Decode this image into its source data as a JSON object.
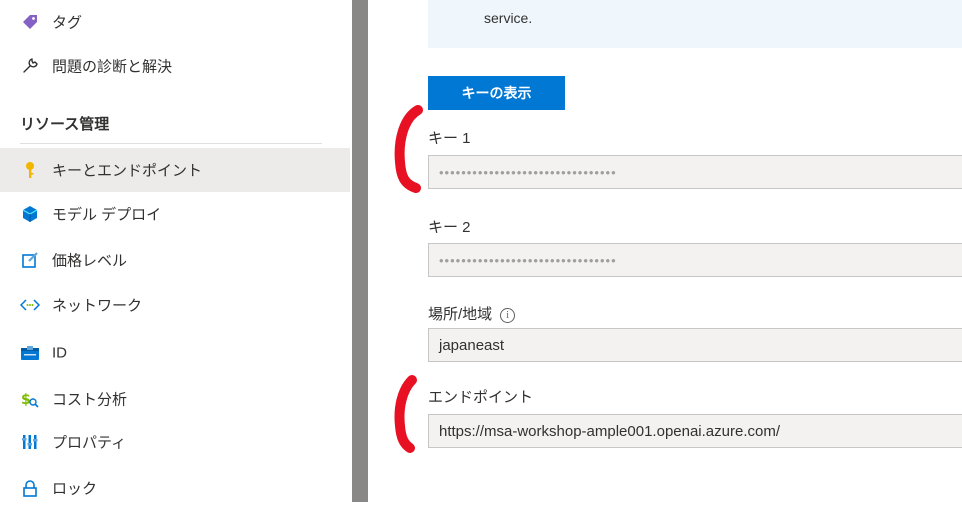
{
  "sidebar": {
    "items_top": [
      {
        "label": "タグ",
        "icon": "tag-icon"
      },
      {
        "label": "問題の診断と解決",
        "icon": "wrench-icon"
      }
    ],
    "section_header": "リソース管理",
    "items": [
      {
        "label": "キーとエンドポイント",
        "icon": "key-icon",
        "active": true
      },
      {
        "label": "モデル デプロイ",
        "icon": "cube-icon"
      },
      {
        "label": "価格レベル",
        "icon": "edit-square-icon"
      },
      {
        "label": "ネットワーク",
        "icon": "network-icon"
      },
      {
        "label": "ID",
        "icon": "id-card-icon"
      },
      {
        "label": "コスト分析",
        "icon": "cost-analysis-icon"
      },
      {
        "label": "プロパティ",
        "icon": "properties-icon"
      },
      {
        "label": "ロック",
        "icon": "lock-icon"
      }
    ]
  },
  "main": {
    "info_text": "service.",
    "show_keys_button": "キーの表示",
    "key1": {
      "label": "キー 1",
      "value": "••••••••••••••••••••••••••••••••"
    },
    "key2": {
      "label": "キー 2",
      "value": "••••••••••••••••••••••••••••••••"
    },
    "location": {
      "label": "場所/地域",
      "info_icon": "i",
      "value": "japaneast"
    },
    "endpoint": {
      "label": "エンドポイント",
      "value": "https://msa-workshop-ample001.openai.azure.com/"
    }
  },
  "colors": {
    "accent": "#0078d4",
    "annotation": "#e81123",
    "splitter": "#8a8886"
  }
}
